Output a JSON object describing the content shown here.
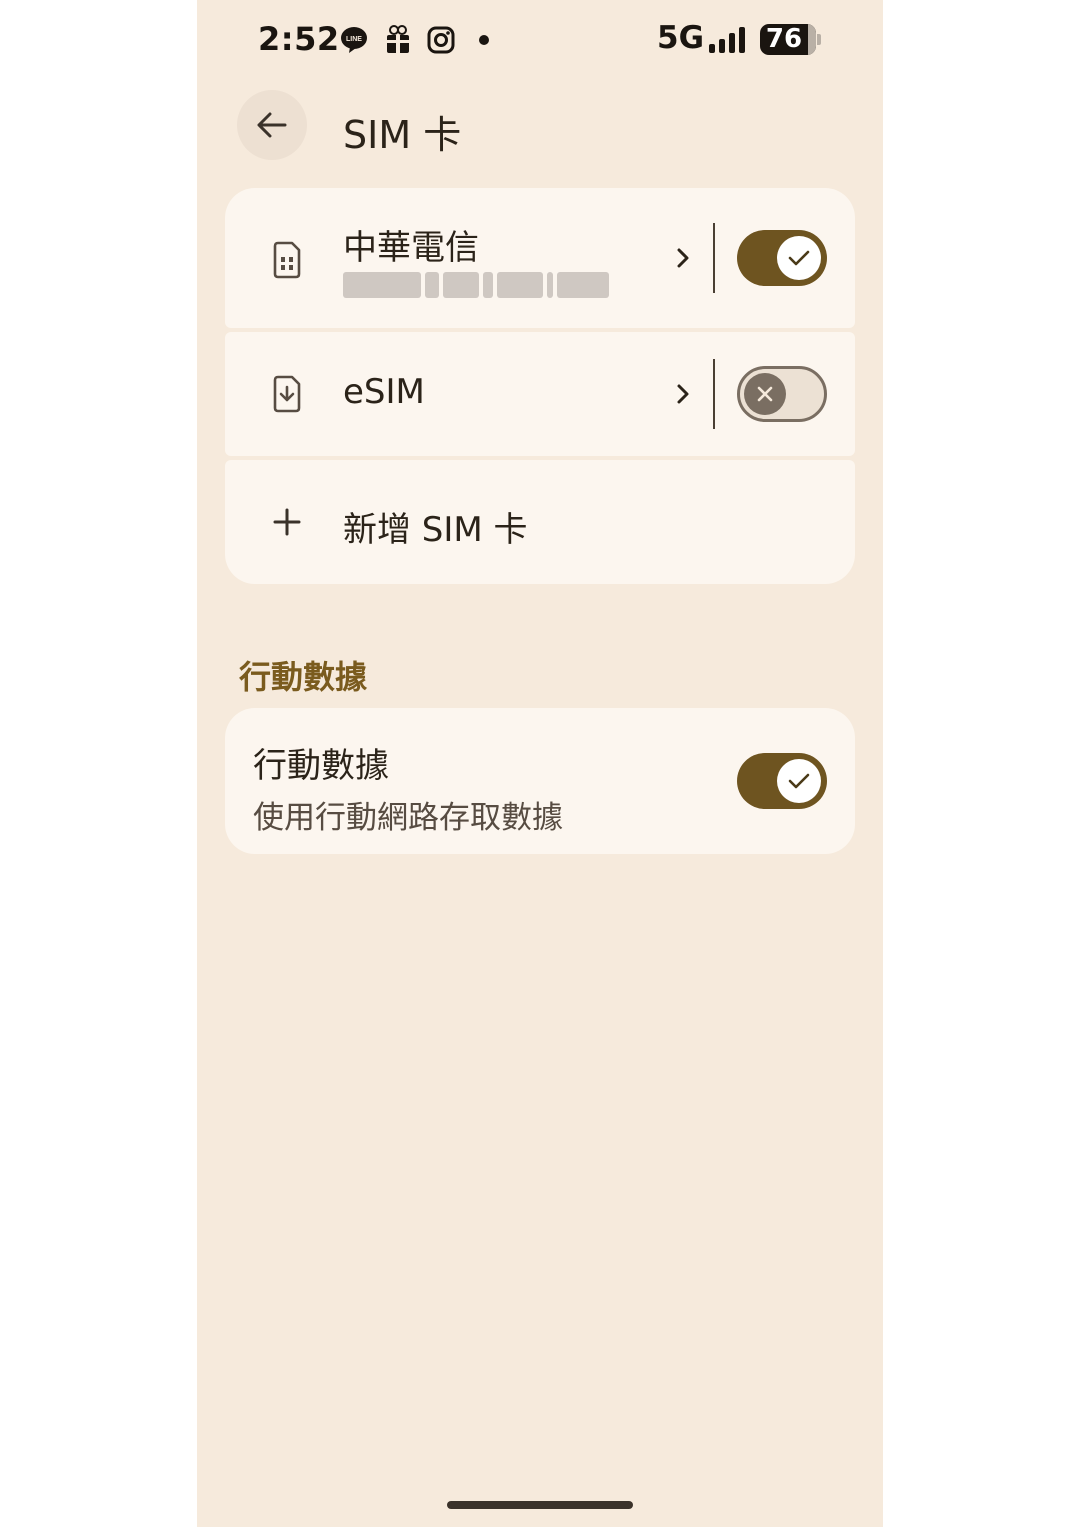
{
  "status_bar": {
    "time": "2:52",
    "network": "5G",
    "battery": "76",
    "notification_icons": [
      "line-icon",
      "gift-icon",
      "instagram-icon",
      "dot-icon"
    ]
  },
  "header": {
    "title": "SIM 卡"
  },
  "sims": [
    {
      "name": "中華電信",
      "icon": "sim-card-icon",
      "enabled": true
    },
    {
      "name": "eSIM",
      "icon": "esim-download-icon",
      "enabled": false
    }
  ],
  "add_sim": {
    "label": "新增 SIM 卡",
    "icon": "plus-icon"
  },
  "mobile_data_section": {
    "heading": "行動數據",
    "item": {
      "title": "行動數據",
      "subtitle": "使用行動網路存取數據",
      "enabled": true
    }
  },
  "colors": {
    "background": "#f6eadc",
    "card": "#fcf6ef",
    "accent": "#6e5420",
    "section_title": "#7a5b1e"
  }
}
